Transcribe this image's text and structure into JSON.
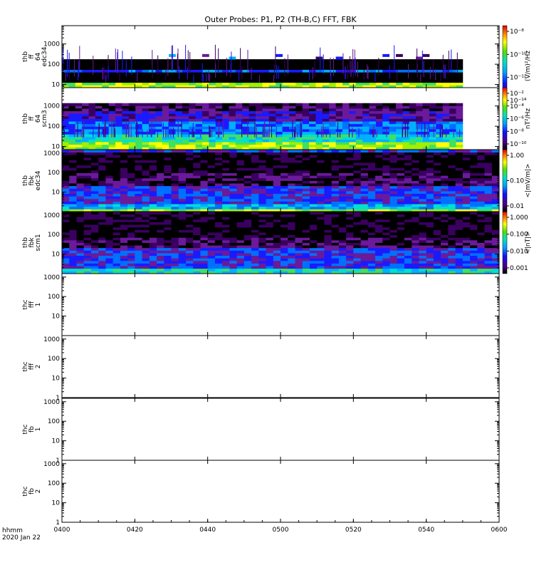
{
  "title": "Outer Probes: P1, P2 (TH-B,C) FFT, FBK",
  "corner": {
    "line1": "hhmm",
    "line2": "2020 Jan 22"
  },
  "x_ticks": [
    "0400",
    "0420",
    "0440",
    "0500",
    "0520",
    "0540",
    "0600"
  ],
  "colorbars": [
    {
      "label": "(V/m)²/Hz",
      "ticks": [
        "10⁻⁸",
        "10⁻¹⁰",
        "10⁻¹²",
        "10⁻¹⁴"
      ]
    },
    {
      "label": "nT²/Hz",
      "ticks": [
        "10⁻²",
        "10⁻⁴",
        "10⁻⁶",
        "10⁻⁸",
        "10⁻¹⁰"
      ]
    },
    {
      "label": "<|mV/m|>",
      "ticks": [
        "1.00",
        "0.10",
        "0.01"
      ]
    },
    {
      "label": "<|nT|>",
      "ticks": [
        "1.000",
        "0.100",
        "0.010",
        "0.001"
      ]
    }
  ],
  "chart_data": {
    "type": "heatmap",
    "x_range": [
      "0400",
      "0600"
    ],
    "y_scale": "log",
    "panels": [
      {
        "ylabel": [
          "thb",
          "ff",
          "64",
          "edc34"
        ],
        "yticks": [
          "10",
          "100",
          "1000"
        ],
        "yrange": [
          7,
          8000
        ],
        "has_data": true,
        "data_end": "0550"
      },
      {
        "ylabel": [
          "thb",
          "ff",
          "64",
          "scm3"
        ],
        "yticks": [
          "10",
          "100",
          "1000"
        ],
        "yrange": [
          7,
          8000
        ],
        "has_data": true,
        "data_end": "0550"
      },
      {
        "ylabel": [
          "thb",
          "fbk",
          "edc34"
        ],
        "yticks": [
          "10",
          "100",
          "1000"
        ],
        "yrange": [
          1,
          1500
        ],
        "has_data": true,
        "data_end": "0600"
      },
      {
        "ylabel": [
          "thb",
          "fbk",
          "scm1"
        ],
        "yticks": [
          "10",
          "100",
          "1000"
        ],
        "yrange": [
          1,
          1500
        ],
        "has_data": true,
        "data_end": "0600"
      },
      {
        "ylabel": [
          "thc",
          "fff",
          "1"
        ],
        "yticks": [
          "10",
          "100",
          "1000"
        ],
        "yrange": [
          1,
          1500
        ],
        "has_data": false
      },
      {
        "ylabel": [
          "thc",
          "fff",
          "2"
        ],
        "yticks": [
          "1",
          "10",
          "100",
          "1000"
        ],
        "yrange": [
          1,
          1500
        ],
        "has_data": false
      },
      {
        "ylabel": [
          "thc",
          "fb",
          "1"
        ],
        "yticks": [
          "1",
          "10",
          "100",
          "1000"
        ],
        "yrange": [
          1,
          1500
        ],
        "has_data": false
      },
      {
        "ylabel": [
          "thc",
          "fb",
          "2"
        ],
        "yticks": [
          "1",
          "10",
          "100",
          "1000"
        ],
        "yrange": [
          1,
          1500
        ],
        "has_data": false
      }
    ]
  }
}
